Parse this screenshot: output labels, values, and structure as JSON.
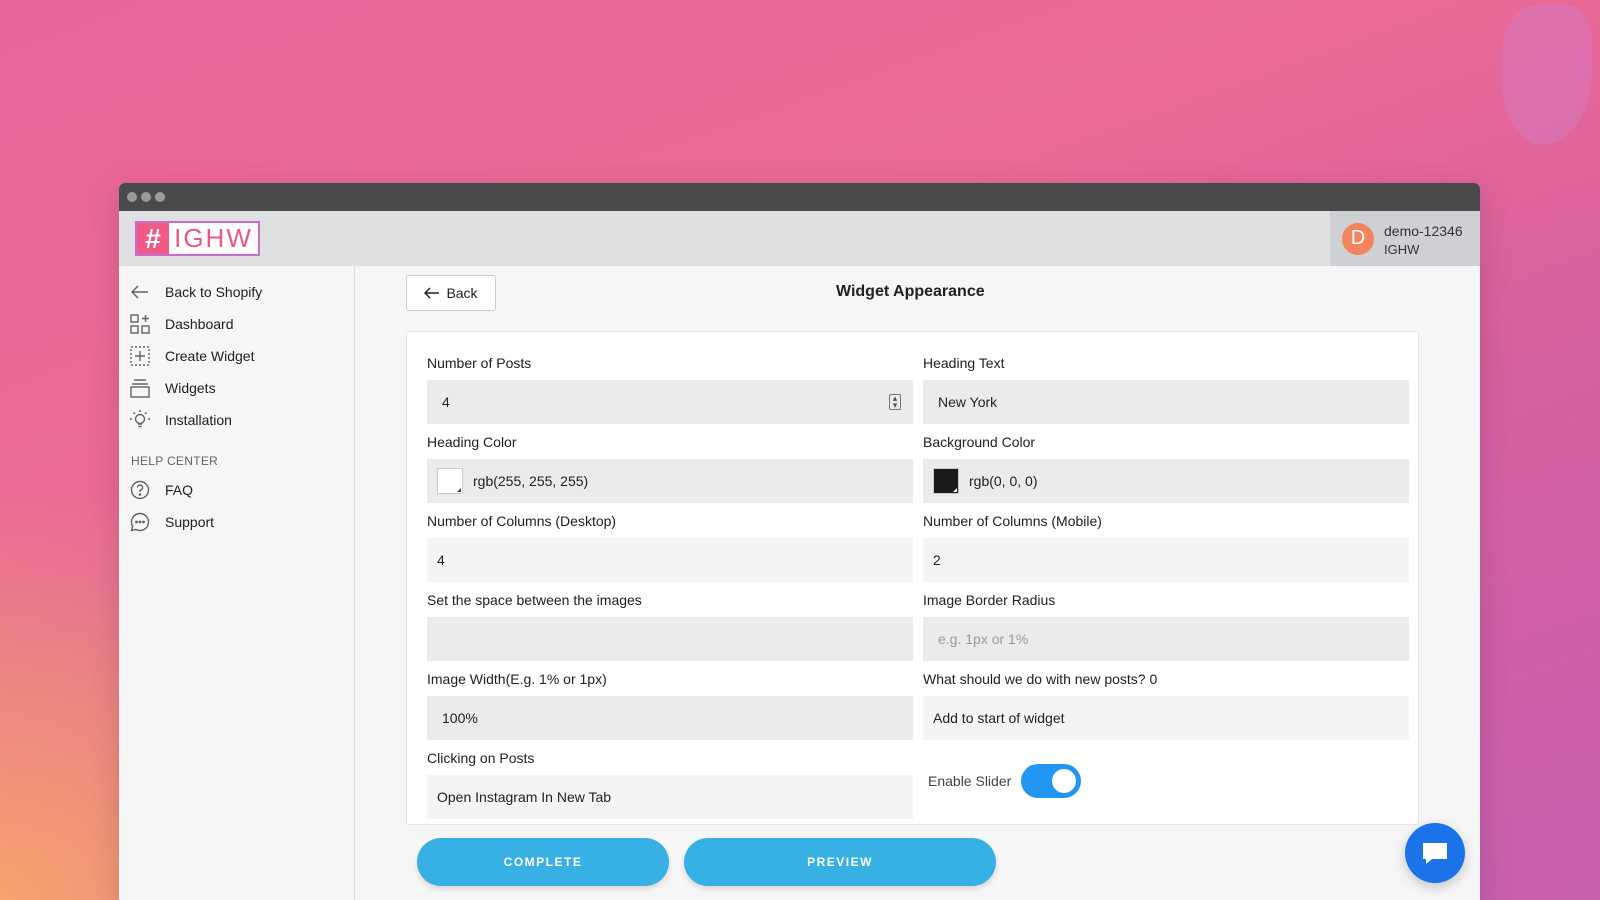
{
  "window": {
    "controls": [
      "dot",
      "dot",
      "dot"
    ]
  },
  "brand": {
    "hash": "#",
    "name": "IGHW"
  },
  "user": {
    "initial": "D",
    "name": "demo-12346",
    "org": "IGHW"
  },
  "sidebar": {
    "items": [
      {
        "label": "Back to Shopify",
        "icon": "arrow-left-icon"
      },
      {
        "label": "Dashboard",
        "icon": "dashboard-icon"
      },
      {
        "label": "Create Widget",
        "icon": "create-widget-icon"
      },
      {
        "label": "Widgets",
        "icon": "widgets-stack-icon"
      },
      {
        "label": "Installation",
        "icon": "lightbulb-icon"
      }
    ],
    "help_heading": "HELP CENTER",
    "help_items": [
      {
        "label": "FAQ",
        "icon": "question-icon"
      },
      {
        "label": "Support",
        "icon": "chat-bubble-icon"
      }
    ]
  },
  "header": {
    "back_label": "Back",
    "title": "Widget Appearance"
  },
  "form": {
    "num_posts": {
      "label": "Number of Posts",
      "value": "4"
    },
    "heading_text": {
      "label": "Heading Text",
      "value": "New York"
    },
    "heading_color": {
      "label": "Heading Color",
      "value": "rgb(255, 255, 255)",
      "swatch": "#ffffff"
    },
    "background_color": {
      "label": "Background Color",
      "value": "rgb(0, 0, 0)",
      "swatch": "#1a1a1a"
    },
    "columns_desktop": {
      "label": "Number of Columns (Desktop)",
      "value": "4"
    },
    "columns_mobile": {
      "label": "Number of Columns (Mobile)",
      "value": "2"
    },
    "space_between": {
      "label": "Set the space between the images",
      "value": ""
    },
    "border_radius": {
      "label": "Image Border Radius",
      "value": "",
      "placeholder": "e.g. 1px or 1%"
    },
    "image_width": {
      "label": "Image Width(E.g. 1% or 1px)",
      "value": "100%"
    },
    "new_posts": {
      "label": "What should we do with new posts? 0",
      "value": "Add to start of widget"
    },
    "clicking_posts": {
      "label": "Clicking on Posts",
      "value": "Open Instagram In New Tab"
    },
    "slider": {
      "label": "Enable Slider",
      "enabled": true
    }
  },
  "actions": {
    "complete": "COMPLETE",
    "preview": "PREVIEW"
  },
  "colors": {
    "accent": "#37b0e3",
    "toggle": "#2196f3",
    "chat": "#1a73e8",
    "brand": "#ef5b86"
  }
}
